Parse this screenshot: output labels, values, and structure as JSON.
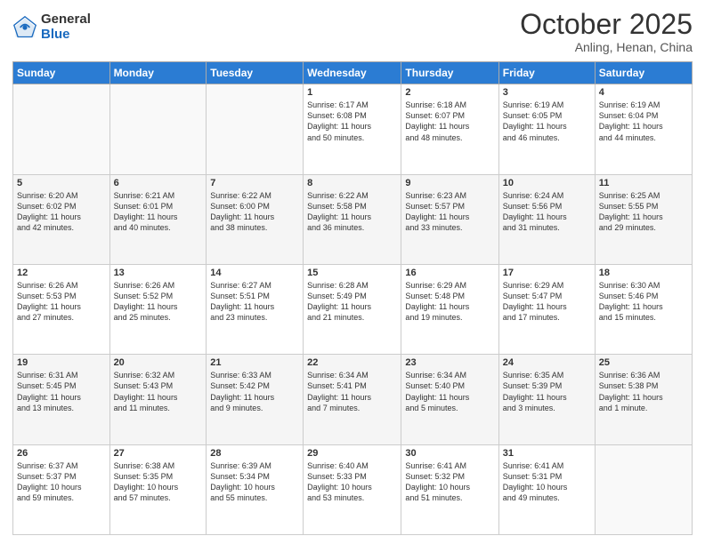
{
  "header": {
    "logo": {
      "general": "General",
      "blue": "Blue"
    },
    "title": "October 2025",
    "subtitle": "Anling, Henan, China"
  },
  "columns": [
    "Sunday",
    "Monday",
    "Tuesday",
    "Wednesday",
    "Thursday",
    "Friday",
    "Saturday"
  ],
  "weeks": [
    [
      {
        "day": "",
        "info": ""
      },
      {
        "day": "",
        "info": ""
      },
      {
        "day": "",
        "info": ""
      },
      {
        "day": "1",
        "info": "Sunrise: 6:17 AM\nSunset: 6:08 PM\nDaylight: 11 hours\nand 50 minutes."
      },
      {
        "day": "2",
        "info": "Sunrise: 6:18 AM\nSunset: 6:07 PM\nDaylight: 11 hours\nand 48 minutes."
      },
      {
        "day": "3",
        "info": "Sunrise: 6:19 AM\nSunset: 6:05 PM\nDaylight: 11 hours\nand 46 minutes."
      },
      {
        "day": "4",
        "info": "Sunrise: 6:19 AM\nSunset: 6:04 PM\nDaylight: 11 hours\nand 44 minutes."
      }
    ],
    [
      {
        "day": "5",
        "info": "Sunrise: 6:20 AM\nSunset: 6:02 PM\nDaylight: 11 hours\nand 42 minutes."
      },
      {
        "day": "6",
        "info": "Sunrise: 6:21 AM\nSunset: 6:01 PM\nDaylight: 11 hours\nand 40 minutes."
      },
      {
        "day": "7",
        "info": "Sunrise: 6:22 AM\nSunset: 6:00 PM\nDaylight: 11 hours\nand 38 minutes."
      },
      {
        "day": "8",
        "info": "Sunrise: 6:22 AM\nSunset: 5:58 PM\nDaylight: 11 hours\nand 36 minutes."
      },
      {
        "day": "9",
        "info": "Sunrise: 6:23 AM\nSunset: 5:57 PM\nDaylight: 11 hours\nand 33 minutes."
      },
      {
        "day": "10",
        "info": "Sunrise: 6:24 AM\nSunset: 5:56 PM\nDaylight: 11 hours\nand 31 minutes."
      },
      {
        "day": "11",
        "info": "Sunrise: 6:25 AM\nSunset: 5:55 PM\nDaylight: 11 hours\nand 29 minutes."
      }
    ],
    [
      {
        "day": "12",
        "info": "Sunrise: 6:26 AM\nSunset: 5:53 PM\nDaylight: 11 hours\nand 27 minutes."
      },
      {
        "day": "13",
        "info": "Sunrise: 6:26 AM\nSunset: 5:52 PM\nDaylight: 11 hours\nand 25 minutes."
      },
      {
        "day": "14",
        "info": "Sunrise: 6:27 AM\nSunset: 5:51 PM\nDaylight: 11 hours\nand 23 minutes."
      },
      {
        "day": "15",
        "info": "Sunrise: 6:28 AM\nSunset: 5:49 PM\nDaylight: 11 hours\nand 21 minutes."
      },
      {
        "day": "16",
        "info": "Sunrise: 6:29 AM\nSunset: 5:48 PM\nDaylight: 11 hours\nand 19 minutes."
      },
      {
        "day": "17",
        "info": "Sunrise: 6:29 AM\nSunset: 5:47 PM\nDaylight: 11 hours\nand 17 minutes."
      },
      {
        "day": "18",
        "info": "Sunrise: 6:30 AM\nSunset: 5:46 PM\nDaylight: 11 hours\nand 15 minutes."
      }
    ],
    [
      {
        "day": "19",
        "info": "Sunrise: 6:31 AM\nSunset: 5:45 PM\nDaylight: 11 hours\nand 13 minutes."
      },
      {
        "day": "20",
        "info": "Sunrise: 6:32 AM\nSunset: 5:43 PM\nDaylight: 11 hours\nand 11 minutes."
      },
      {
        "day": "21",
        "info": "Sunrise: 6:33 AM\nSunset: 5:42 PM\nDaylight: 11 hours\nand 9 minutes."
      },
      {
        "day": "22",
        "info": "Sunrise: 6:34 AM\nSunset: 5:41 PM\nDaylight: 11 hours\nand 7 minutes."
      },
      {
        "day": "23",
        "info": "Sunrise: 6:34 AM\nSunset: 5:40 PM\nDaylight: 11 hours\nand 5 minutes."
      },
      {
        "day": "24",
        "info": "Sunrise: 6:35 AM\nSunset: 5:39 PM\nDaylight: 11 hours\nand 3 minutes."
      },
      {
        "day": "25",
        "info": "Sunrise: 6:36 AM\nSunset: 5:38 PM\nDaylight: 11 hours\nand 1 minute."
      }
    ],
    [
      {
        "day": "26",
        "info": "Sunrise: 6:37 AM\nSunset: 5:37 PM\nDaylight: 10 hours\nand 59 minutes."
      },
      {
        "day": "27",
        "info": "Sunrise: 6:38 AM\nSunset: 5:35 PM\nDaylight: 10 hours\nand 57 minutes."
      },
      {
        "day": "28",
        "info": "Sunrise: 6:39 AM\nSunset: 5:34 PM\nDaylight: 10 hours\nand 55 minutes."
      },
      {
        "day": "29",
        "info": "Sunrise: 6:40 AM\nSunset: 5:33 PM\nDaylight: 10 hours\nand 53 minutes."
      },
      {
        "day": "30",
        "info": "Sunrise: 6:41 AM\nSunset: 5:32 PM\nDaylight: 10 hours\nand 51 minutes."
      },
      {
        "day": "31",
        "info": "Sunrise: 6:41 AM\nSunset: 5:31 PM\nDaylight: 10 hours\nand 49 minutes."
      },
      {
        "day": "",
        "info": ""
      }
    ]
  ]
}
